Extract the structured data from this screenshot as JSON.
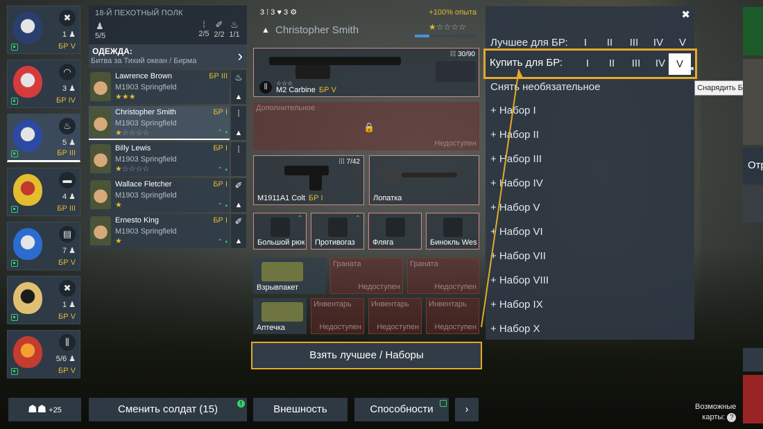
{
  "squads": [
    {
      "role_icon": "crossed-guns-icon",
      "role_glyph": "✖",
      "count": "1",
      "br": "БР V",
      "emblem_colors": [
        "#2a3f70",
        "#e4e4e4"
      ]
    },
    {
      "role_icon": "helmet-icon",
      "role_glyph": "◠",
      "count": "3",
      "br": "БР IV",
      "emblem_colors": [
        "#d63b3b",
        "#e4e4e4"
      ]
    },
    {
      "role_icon": "flame-icon",
      "role_glyph": "♨",
      "count": "5",
      "br": "БР III",
      "emblem_colors": [
        "#2c49a3",
        "#e4e4e4"
      ]
    },
    {
      "role_icon": "tank-icon",
      "role_glyph": "▬",
      "count": "4",
      "br": "БР III",
      "emblem_colors": [
        "#e4bd2e",
        "#c0392b"
      ]
    },
    {
      "role_icon": "document-icon",
      "role_glyph": "▤",
      "count": "7",
      "br": "БР V",
      "emblem_colors": [
        "#2c6bd0",
        "#e4e4e4"
      ]
    },
    {
      "role_icon": "crossed-guns-icon",
      "role_glyph": "✖",
      "count": "1",
      "br": "БР V",
      "emblem_colors": [
        "#e0c070",
        "#1b1b1b"
      ]
    },
    {
      "role_icon": "ammo-icon",
      "role_glyph": "⫼",
      "count": "5/6",
      "br": "БР V",
      "emblem_colors": [
        "#c43b2f",
        "#f2a030"
      ]
    }
  ],
  "regiment": {
    "name": "18-Й ПЕХОТНЫЙ ПОЛК",
    "count": "5/5",
    "slots": [
      {
        "icon": "rifle-icon",
        "glyph": "⁞",
        "value": "2/5"
      },
      {
        "icon": "wrench-icon",
        "glyph": "✐",
        "value": "2/2"
      },
      {
        "icon": "flame-icon",
        "glyph": "♨",
        "value": "1/1"
      }
    ]
  },
  "outfit": {
    "title": "ОДЕЖДА:",
    "subtitle": "Битва за Тихий океан / Бирма"
  },
  "soldiers": [
    {
      "name": "Lawrence Brown",
      "weapon": "M1903 Springfield",
      "br": "БР III",
      "stars_on": "★★★",
      "stars_off": "",
      "upgrade": "",
      "side_top": "♨",
      "side_bottom": "▲"
    },
    {
      "name": "Christopher Smith",
      "weapon": "M1903 Springfield",
      "br": "БР I",
      "stars_on": "★",
      "stars_off": "☆☆☆☆",
      "upgrade": "⌃",
      "side_top": "⁞",
      "side_bottom": "▲"
    },
    {
      "name": "Billy Lewis",
      "weapon": "M1903 Springfield",
      "br": "БР I",
      "stars_on": "★",
      "stars_off": "☆☆☆☆",
      "upgrade": "⌃",
      "side_top": "⁞",
      "side_bottom": ""
    },
    {
      "name": "Wallace Fletcher",
      "weapon": "M1903 Springfield",
      "br": "БР I",
      "stars_on": "★",
      "stars_off": "",
      "upgrade": "⌃",
      "side_top": "✐",
      "side_bottom": "▲"
    },
    {
      "name": "Ernesto King",
      "weapon": "M1903 Springfield",
      "br": "БР I",
      "stars_on": "★",
      "stars_off": "",
      "upgrade": "⌃",
      "side_top": "✐",
      "side_bottom": "▲"
    }
  ],
  "soldier": {
    "perks": "3 ⁞  3 ♥  3 ⚙",
    "xp_bonus": "+100% опыта",
    "name": "Christopher Smith",
    "rank_glyph": "▲",
    "xp_stars_on": "★",
    "xp_stars_off": "☆☆☆☆",
    "xp_progress": 0.24
  },
  "equipment": {
    "primary": {
      "name": "M2 Carbine",
      "br": "БР V",
      "ammo": "⁞⁞⁞ 30/90",
      "stars": "☆☆☆"
    },
    "extra": {
      "title": "Дополнительное",
      "status": "Недоступен"
    },
    "pistol": {
      "name": "M1911A1 Colt",
      "br": "БР I",
      "ammo": "⁞⁞⁞ 7/42"
    },
    "melee": {
      "name": "Лопатка"
    },
    "gear": [
      {
        "name": "Большой рюкзак",
        "up": "⌃"
      },
      {
        "name": "Противогаз",
        "up": "⌃"
      },
      {
        "name": "Фляга",
        "up": ""
      },
      {
        "name": "Бинокль Westinghouse",
        "up": ""
      }
    ],
    "row1": [
      {
        "name": "Взрывпакет",
        "title": "",
        "status": ""
      },
      {
        "name": "",
        "title": "Граната",
        "status": "Недоступен"
      },
      {
        "name": "",
        "title": "Граната",
        "status": "Недоступен"
      }
    ],
    "row2": [
      {
        "name": "Аптечка",
        "title": "",
        "status": ""
      },
      {
        "name": "",
        "title": "Инвентарь",
        "status": "Недоступен"
      },
      {
        "name": "",
        "title": "Инвентарь",
        "status": "Недоступен"
      },
      {
        "name": "",
        "title": "Инвентарь",
        "status": "Недоступен"
      }
    ]
  },
  "dropdown": {
    "close": "✖",
    "best_label": "Лучшее для БР:",
    "buy_label": "Купить для БР:",
    "levels": [
      "I",
      "II",
      "III",
      "IV",
      "V"
    ],
    "remove_label": "Снять необязательное",
    "kits": [
      "+ Набор I",
      "+ Набор II",
      "+ Набор III",
      "+ Набор IV",
      "+ Набор V",
      "+ Набор VI",
      "+ Набор VII",
      "+ Набор VIII",
      "+ Набор IX",
      "+ Набор X"
    ],
    "tooltip": "Снарядить БР V"
  },
  "buttons": {
    "take_best": "Взять лучшее / Наборы",
    "squad_bonus": "+25",
    "change_soldier": "Сменить солдат (15)",
    "appearance": "Внешность",
    "abilities": "Способности",
    "next": "›"
  },
  "right_strip": {
    "partial_text": "Отр"
  },
  "maps_note": {
    "line1": "Возможные",
    "line2": "карты:",
    "help": "?"
  },
  "colors": {
    "accent": "#e6a92a",
    "br": "#e6b830",
    "positive": "#35d26a",
    "xp_bar": "#4d8fd8"
  }
}
